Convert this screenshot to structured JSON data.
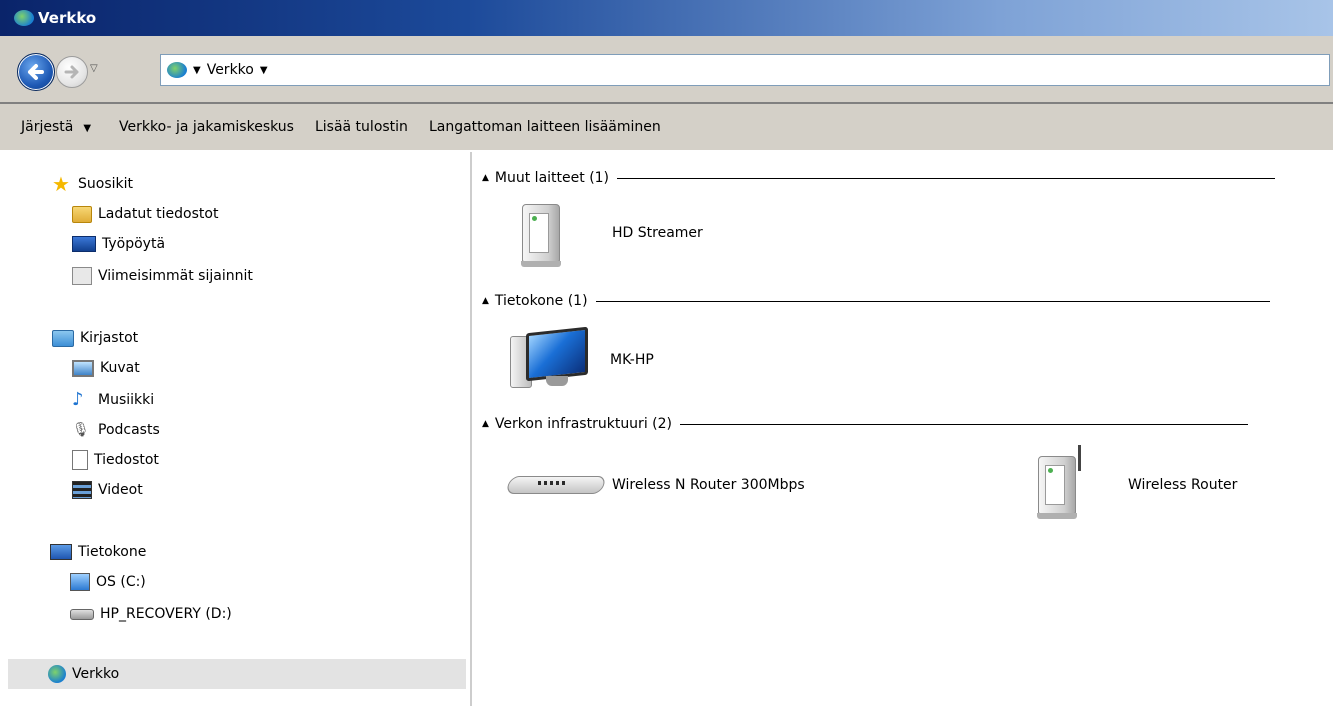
{
  "window": {
    "title": "Verkko"
  },
  "address": {
    "crumbs": [
      "Verkko"
    ]
  },
  "toolbar": {
    "organize": "Järjestä",
    "network_center": "Verkko- ja jakamiskeskus",
    "add_printer": "Lisää tulostin",
    "add_wireless": "Langattoman laitteen lisääminen"
  },
  "nav": {
    "favorites": "Suosikit",
    "downloads": "Ladatut tiedostot",
    "desktop": "Työpöytä",
    "recent": "Viimeisimmät sijainnit",
    "libraries": "Kirjastot",
    "pictures": "Kuvat",
    "music": "Musiikki",
    "podcasts": "Podcasts",
    "documents": "Tiedostot",
    "videos": "Videot",
    "computer": "Tietokone",
    "drive_c": "OS (C:)",
    "drive_d": "HP_RECOVERY (D:)",
    "network": "Verkko"
  },
  "groups": [
    {
      "title": "Muut laitteet (1)",
      "devices": [
        {
          "name": "HD Streamer",
          "icon": "media-device-icon"
        }
      ]
    },
    {
      "title": "Tietokone (1)",
      "devices": [
        {
          "name": "MK-HP",
          "icon": "computer-icon"
        }
      ]
    },
    {
      "title": "Verkon infrastruktuuri (2)",
      "devices": [
        {
          "name": "Wireless N Router 300Mbps",
          "icon": "router-icon"
        },
        {
          "name": "Wireless Router",
          "icon": "wireless-router-icon"
        }
      ]
    }
  ]
}
